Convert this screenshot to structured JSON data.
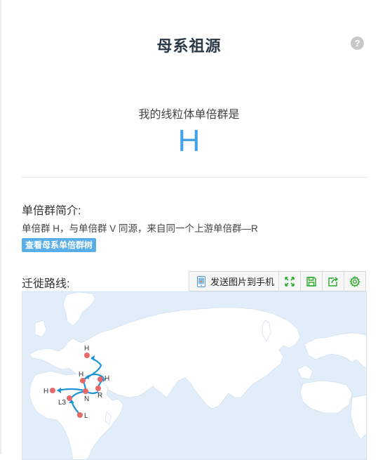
{
  "header": {
    "title": "母系祖源"
  },
  "haplogroup": {
    "label": "我的线粒体单倍群是",
    "value": "H"
  },
  "intro": {
    "heading": "单倍群简介:",
    "text": "单倍群 H，与单倍群 V 同源，来自同一个上游单倍群—R",
    "tree_button": "查看母系单倍群树"
  },
  "route": {
    "heading": "迁徙路线:",
    "toolbar": {
      "send_label": "发送图片到手机",
      "icons": [
        "phone-icon",
        "fullscreen-icon",
        "save-icon",
        "share-icon",
        "settings-icon"
      ]
    },
    "map_labels": {
      "h_north": "H",
      "h_mid": "H",
      "h_east": "H",
      "h_west": "H",
      "n": "N",
      "r": "R",
      "l3": "L3",
      "l": "L"
    }
  },
  "colors": {
    "accent": "#42a3e8",
    "button": "#57aee9",
    "marker": "#e8686a",
    "arrow": "#1e93d6",
    "toolbar_icon": "#2aa82a",
    "ocean": "#e1eef9",
    "land": "#ffffff"
  }
}
